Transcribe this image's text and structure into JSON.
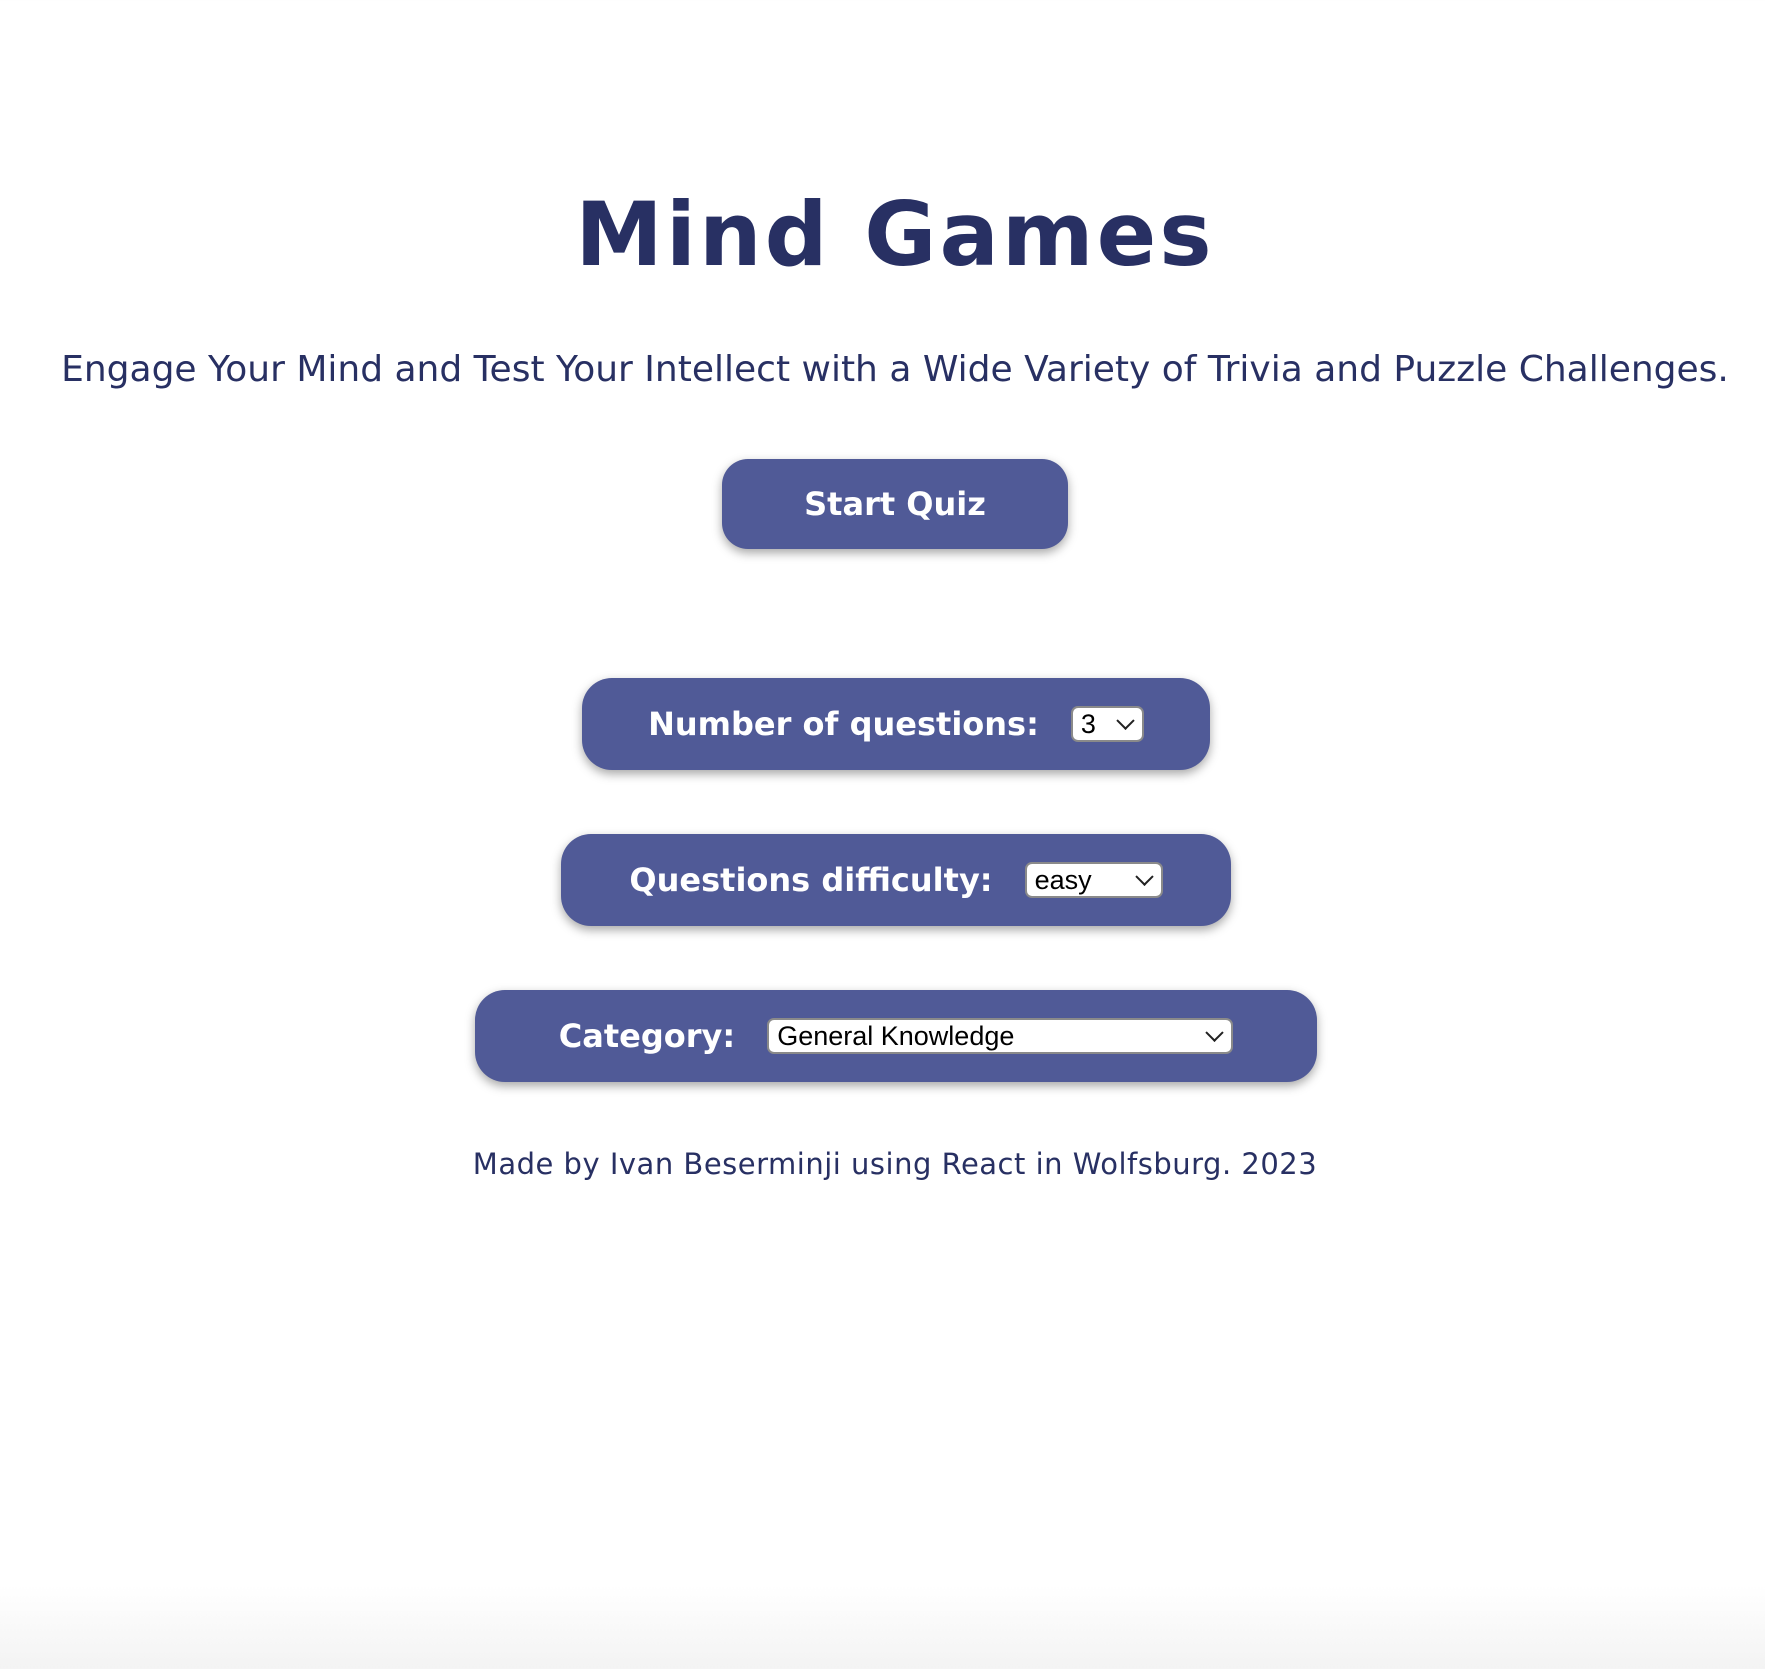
{
  "header": {
    "title": "Mind Games",
    "subtitle": "Engage Your Mind and Test Your Intellect with a Wide Variety of Trivia and Puzzle Challenges."
  },
  "actions": {
    "start_label": "Start Quiz"
  },
  "options": {
    "num_questions": {
      "label": "Number of questions:",
      "selected": "3"
    },
    "difficulty": {
      "label": "Questions difficulty:",
      "selected": "easy"
    },
    "category": {
      "label": "Category:",
      "selected": "General Knowledge"
    }
  },
  "footer": {
    "text": "Made by Ivan Beserminji using React in Wolfsburg. 2023"
  },
  "colors": {
    "primary": "#505a97",
    "text": "#283063",
    "background": "#ffffff"
  },
  "icons": {
    "select_arrow": "chevron-down-icon"
  }
}
